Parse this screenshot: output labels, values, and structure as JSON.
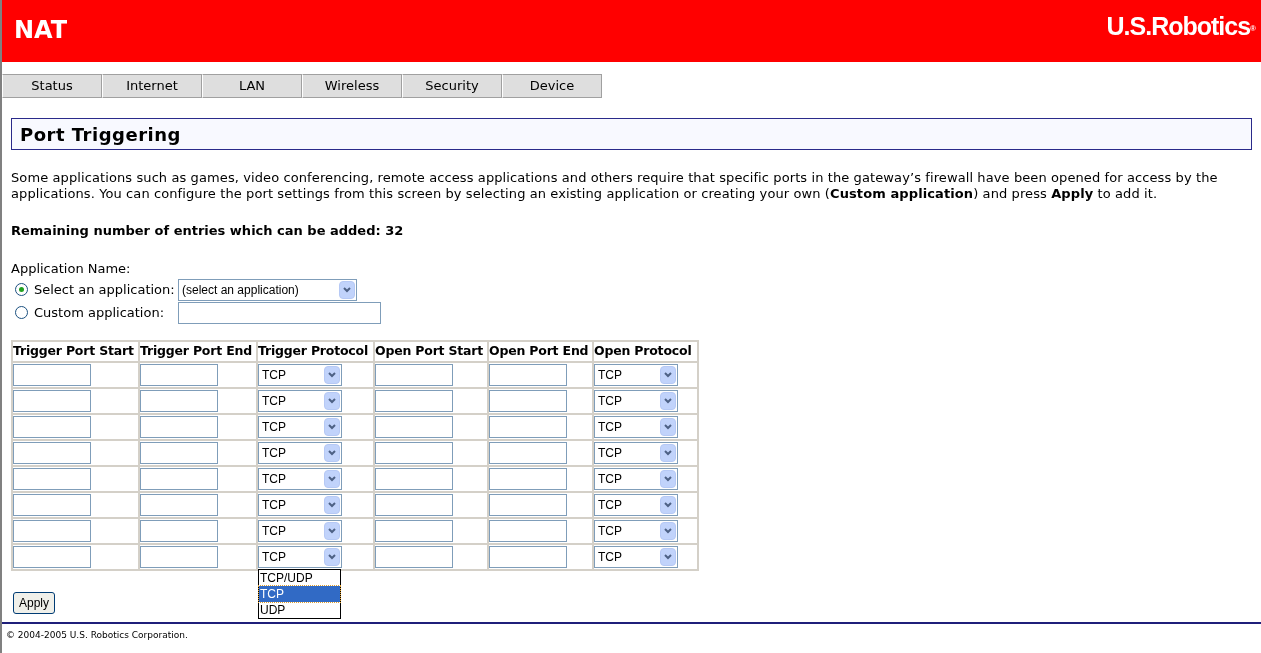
{
  "header": {
    "title": "NAT",
    "logo": "U.S.Robotics",
    "logo_mark": "®"
  },
  "tabs": [
    {
      "label": "Status",
      "selected": false
    },
    {
      "label": "Internet",
      "selected": false
    },
    {
      "label": "LAN",
      "selected": false
    },
    {
      "label": "Wireless",
      "selected": false
    },
    {
      "label": "Security",
      "selected": false
    },
    {
      "label": "Device",
      "selected": false
    }
  ],
  "page_title": "Port Triggering",
  "description": "Some applications such as games, video conferencing, remote access applications and others require that specific ports in the gateway’s firewall have been opened for access by the applications. You can configure the port settings from this screen by selecting an existing application or creating your own (**Custom application**) and press **Apply** to add it.",
  "remaining": "Remaining number of entries which can be added: 32",
  "application_name": {
    "label": "Application Name:",
    "options": [
      {
        "label": "Select an application:",
        "selected": true,
        "kind": "select",
        "value": "(select an application)"
      },
      {
        "label": "Custom application:",
        "selected": false,
        "kind": "text"
      }
    ]
  },
  "table": {
    "columns": [
      "Trigger Port Start",
      "Trigger Port End",
      "Trigger Protocol",
      "Open Port Start",
      "Open Port End",
      "Open Protocol"
    ],
    "rows": [
      {
        "trigger_protocol": "TCP",
        "open_protocol": "TCP"
      },
      {
        "trigger_protocol": "TCP",
        "open_protocol": "TCP"
      },
      {
        "trigger_protocol": "TCP",
        "open_protocol": "TCP"
      },
      {
        "trigger_protocol": "TCP",
        "open_protocol": "TCP"
      },
      {
        "trigger_protocol": "TCP",
        "open_protocol": "TCP"
      },
      {
        "trigger_protocol": "TCP",
        "open_protocol": "TCP"
      },
      {
        "trigger_protocol": "TCP",
        "open_protocol": "TCP"
      },
      {
        "trigger_protocol": "TCP",
        "open_protocol": "TCP",
        "trigger_menu": [
          {
            "label": "TCP/UDP",
            "selected": false
          },
          {
            "label": "TCP",
            "selected": true
          },
          {
            "label": "UDP",
            "selected": false
          }
        ]
      }
    ]
  },
  "apply_button": "Apply",
  "footer": "© 2004-2005 U.S. Robotics Corporation."
}
